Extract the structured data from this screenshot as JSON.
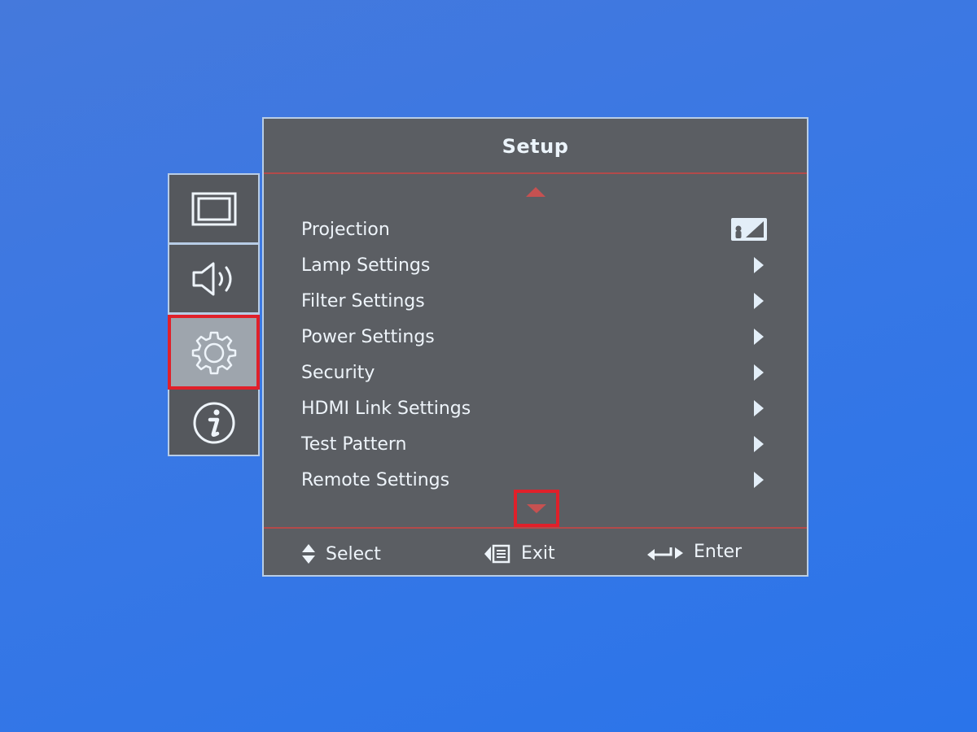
{
  "colors": {
    "background": "#3a78e4",
    "panel": "#5b5e63",
    "border": "#b8cde6",
    "divider": "#b34a4a",
    "scroll_arrow": "#c65151",
    "highlight": "#e0202a",
    "selected_tab": "#9ea5ad",
    "text": "#eef4fa"
  },
  "rail": {
    "items": [
      {
        "name": "display",
        "icon": "display-icon",
        "selected": false
      },
      {
        "name": "audio",
        "icon": "speaker-icon",
        "selected": false
      },
      {
        "name": "setup",
        "icon": "gear-icon",
        "selected": true
      },
      {
        "name": "info",
        "icon": "info-icon",
        "selected": false
      }
    ]
  },
  "panel": {
    "title": "Setup",
    "scroll_up_icon": "triangle-up-icon",
    "scroll_down_icon": "triangle-down-icon",
    "items": [
      {
        "label": "Projection",
        "indicator": "projection-front-icon"
      },
      {
        "label": "Lamp Settings",
        "indicator": "chevron-right-icon"
      },
      {
        "label": "Filter Settings",
        "indicator": "chevron-right-icon"
      },
      {
        "label": "Power Settings",
        "indicator": "chevron-right-icon"
      },
      {
        "label": "Security",
        "indicator": "chevron-right-icon"
      },
      {
        "label": "HDMI Link Settings",
        "indicator": "chevron-right-icon"
      },
      {
        "label": "Test Pattern",
        "indicator": "chevron-right-icon"
      },
      {
        "label": "Remote Settings",
        "indicator": "chevron-right-icon"
      }
    ]
  },
  "footer": {
    "select_label": "Select",
    "exit_label": "Exit",
    "enter_label": "Enter"
  }
}
